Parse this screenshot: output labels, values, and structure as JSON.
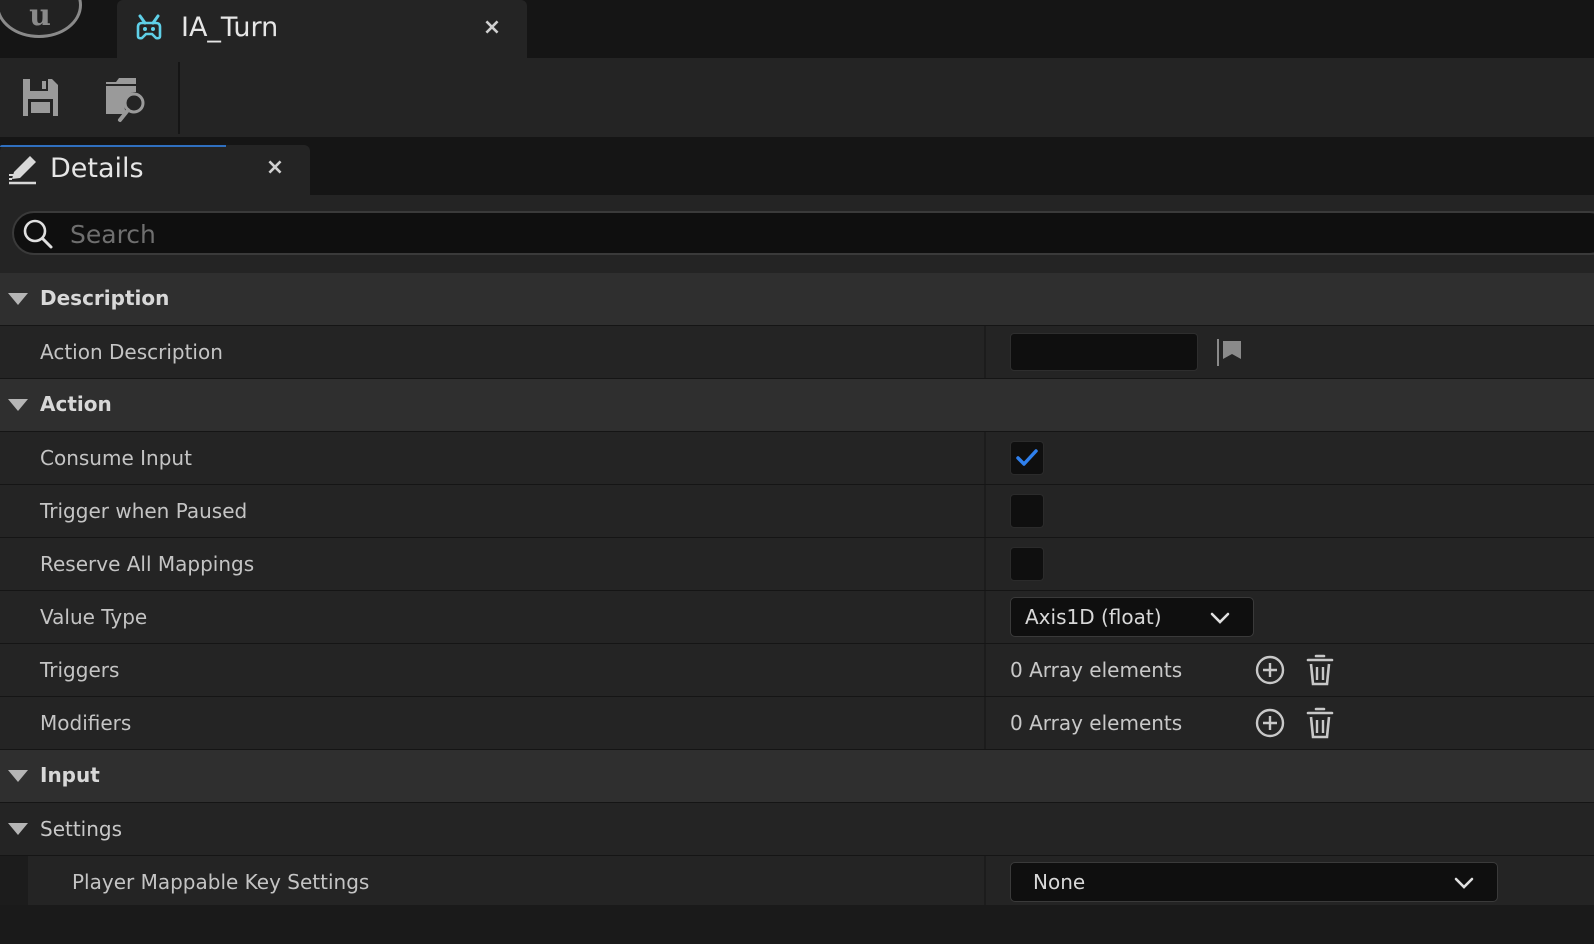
{
  "app": {
    "logo_icon": "unreal-engine-logo-icon",
    "logo_text": "u"
  },
  "document_tab": {
    "icon": "input-action-icon",
    "title": "IA_Turn",
    "close": "×"
  },
  "toolbar": {
    "buttons": [
      {
        "icon": "save-icon"
      },
      {
        "icon": "browse-to-asset-icon"
      }
    ]
  },
  "details_panel": {
    "icon": "details-pencil-icon",
    "title": "Details",
    "close": "×",
    "accent_color": "#2f6fbf"
  },
  "search": {
    "placeholder": "Search",
    "value": ""
  },
  "sections": {
    "description": {
      "label": "Description",
      "properties": {
        "action_description": {
          "name": "Action Description",
          "value": "",
          "flag_icon": "localization-flag-icon"
        }
      }
    },
    "action": {
      "label": "Action",
      "properties": {
        "consume_input": {
          "name": "Consume Input",
          "checked": true,
          "check_color": "#2f80ed"
        },
        "trigger_when_paused": {
          "name": "Trigger when Paused",
          "checked": false
        },
        "reserve_all_mappings": {
          "name": "Reserve All Mappings",
          "checked": false
        },
        "value_type": {
          "name": "Value Type",
          "selected": "Axis1D (float)"
        },
        "triggers": {
          "name": "Triggers",
          "value": "0 Array elements"
        },
        "modifiers": {
          "name": "Modifiers",
          "value": "0 Array elements"
        }
      }
    },
    "input": {
      "label": "Input"
    },
    "settings": {
      "label": "Settings",
      "properties": {
        "player_mappable_key_settings": {
          "name": "Player Mappable Key Settings",
          "selected": "None"
        }
      }
    }
  }
}
